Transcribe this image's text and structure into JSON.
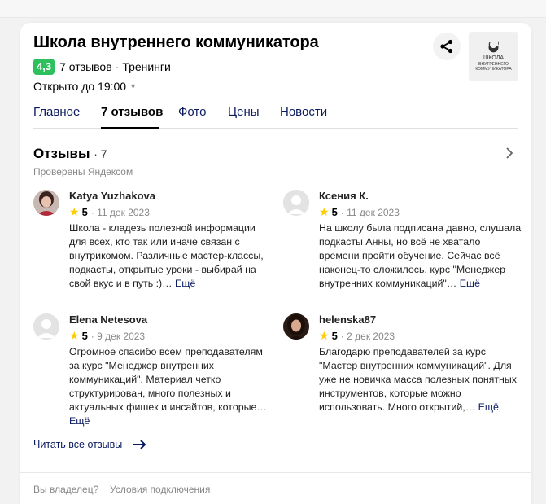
{
  "org": {
    "title": "Школа внутреннего коммуникатора",
    "rating": "4,3",
    "reviews_count": "7 отзывов",
    "category": "Тренинги",
    "hours": "Открыто до 19:00",
    "logo_text_top": "ШКОЛА",
    "logo_text_mid": "ВНУТРЕННЕГО",
    "logo_text_bot": "КОММУНИКАТОРА"
  },
  "tabs": [
    {
      "label": "Главное"
    },
    {
      "label": "7 отзывов"
    },
    {
      "label": "Фото"
    },
    {
      "label": "Цены"
    },
    {
      "label": "Новости"
    }
  ],
  "reviews_section": {
    "title": "Отзывы",
    "count": "· 7",
    "verified": "Проверены Яндексом",
    "read_all": "Читать все отзывы"
  },
  "reviews": [
    {
      "name": "Katya Yuzhakova",
      "score": "5",
      "date": "11 дек 2023",
      "text": "Школа - кладезь полезной информации для всех, кто так или иначе связан с внутрикомом. Различные мастер-классы, подкасты, открытые уроки - выбирай на свой вкус и в путь :)…",
      "more": "Ещё"
    },
    {
      "name": "Ксения К.",
      "score": "5",
      "date": "11 дек 2023",
      "text": "На школу была подписана давно, слушала подкасты Анны, но всё не хватало времени пройти обучение. Сейчас всё наконец-то сложилось, курс \"Менеджер внутренних коммуникаций\"…",
      "more": "Ещё"
    },
    {
      "name": "Elena Netesova",
      "score": "5",
      "date": "9 дек 2023",
      "text": "Огромное спасибо всем преподавателям за курс \"Менеджер внутренних коммуникаций\". Материал четко структурирован, много полезных и актуальных фишек и инсайтов, которые…",
      "more": "Ещё"
    },
    {
      "name": "helenska87",
      "score": "5",
      "date": "2 дек 2023",
      "text": "Благодарю преподавателей за курс \"Мастер внутренних коммуникаций\". Для уже не новичка масса полезных понятных инструментов, которые можно использовать. Много открытий,…",
      "more": "Ещё"
    }
  ],
  "footer": {
    "owner": "Вы владелец?",
    "terms": "Условия подключения"
  },
  "colors": {
    "rating_badge": "#2ec05c",
    "link": "#0a1a60",
    "star": "#ffcc00"
  }
}
